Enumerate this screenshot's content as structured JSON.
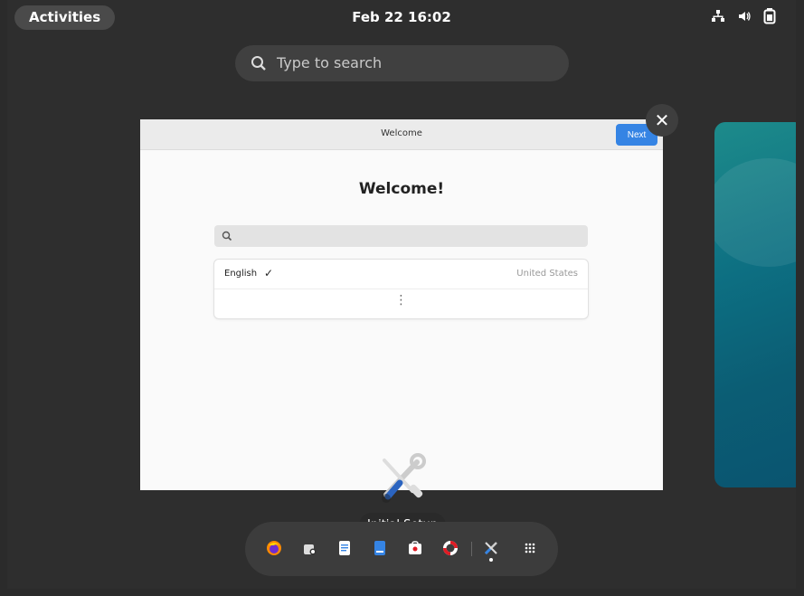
{
  "topbar": {
    "activities": "Activities",
    "clock": "Feb 22  16:02",
    "tray_icons": [
      "network-icon",
      "volume-icon",
      "battery-icon"
    ]
  },
  "search": {
    "placeholder": "Type to search"
  },
  "window": {
    "title": "Welcome",
    "next_label": "Next",
    "heading": "Welcome!",
    "languages": [
      {
        "name": "English",
        "selected": true,
        "country": "United States"
      }
    ],
    "more_label": "⋮"
  },
  "close_label": "✕",
  "app_label": "Initial Setup",
  "dash": {
    "apps": [
      "firefox-icon",
      "software-icon",
      "text-editor-icon",
      "document-viewer-icon",
      "help-icon",
      "initial-setup-icon",
      "show-apps-icon"
    ]
  },
  "colors": {
    "accent": "#3584e4",
    "panel_bg": "#2e2e2e",
    "window_bg": "#fafafa"
  }
}
